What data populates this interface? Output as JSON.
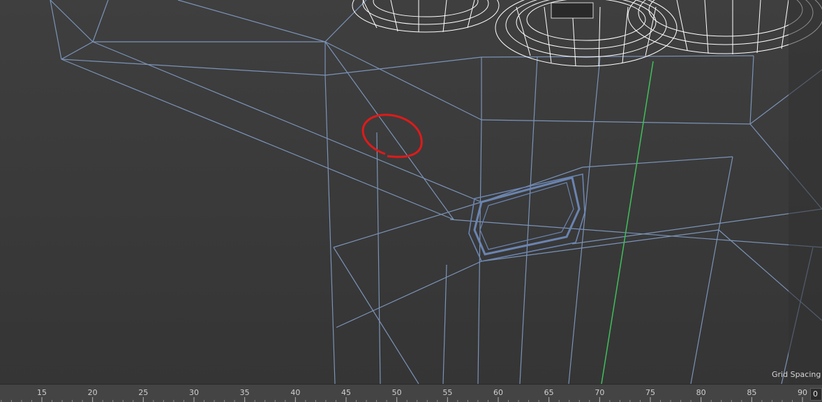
{
  "viewport": {
    "grid_spacing_label": "Grid Spacing :",
    "colors": {
      "background": "#3a3a3a",
      "wireframe": "#7b93b8",
      "selected_wire": "#6a84b0",
      "hi_wire": "#ffffff",
      "axis_line": "#3fbf5a",
      "annotation": "#e01a1a"
    }
  },
  "timeline": {
    "ticks": [
      "15",
      "20",
      "25",
      "30",
      "35",
      "40",
      "45",
      "50",
      "55",
      "60",
      "65",
      "70",
      "75",
      "80",
      "85",
      "90"
    ],
    "current_frame": "0"
  }
}
